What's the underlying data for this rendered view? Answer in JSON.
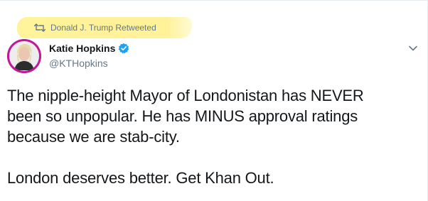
{
  "retweet": {
    "icon": "retweet-icon",
    "text": "Donald J. Trump Retweeted",
    "highlight_color": "#fff18c"
  },
  "author": {
    "display_name": "Katie Hopkins",
    "username": "@KTHopkins",
    "verified": true,
    "verified_icon": "verified-badge-icon",
    "verified_color": "#1da1f2",
    "avatar_border_color": "#c2189a"
  },
  "menu": {
    "icon": "chevron-down-icon"
  },
  "tweet": {
    "lines": [
      "The nipple-height Mayor of Londonistan has NEVER",
      "been so unpopular. He has MINUS approval ratings",
      "because we are stab-city."
    ],
    "final_line": "London deserves better. Get Khan Out."
  }
}
